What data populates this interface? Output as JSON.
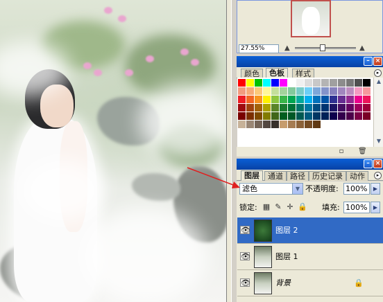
{
  "navigator": {
    "zoom_value": "27.55%",
    "zoom_level_fraction": 0.45
  },
  "swatches_panel": {
    "tabs": [
      {
        "label": "颜色",
        "active": false
      },
      {
        "label": "色板",
        "active": true
      },
      {
        "label": "样式",
        "active": false
      }
    ],
    "colors": [
      "#ff0000",
      "#ffff00",
      "#00c000",
      "#00ffff",
      "#0000ff",
      "#ff00ff",
      "#ffffff",
      "#f0f0f0",
      "#dcdcdc",
      "#c8c8c8",
      "#b4b4b4",
      "#a0a0a0",
      "#8c8c8c",
      "#787878",
      "#505050",
      "#000000",
      "#f29b7f",
      "#f6ab79",
      "#fcc979",
      "#fff799",
      "#c4df9b",
      "#a3d39c",
      "#82ca9c",
      "#7accc8",
      "#6dcff6",
      "#7da7d9",
      "#8393ca",
      "#8781bd",
      "#a186be",
      "#bd8cbf",
      "#f49ac1",
      "#f6989d",
      "#ed1c24",
      "#f26522",
      "#f7941d",
      "#fff200",
      "#8dc63f",
      "#39b54a",
      "#00a651",
      "#00a99d",
      "#00aeef",
      "#0072bc",
      "#0054a6",
      "#2e3192",
      "#662d91",
      "#92278f",
      "#ec008c",
      "#ed145b",
      "#9e0b0f",
      "#a0410d",
      "#a36209",
      "#aba000",
      "#598527",
      "#1a7b30",
      "#007236",
      "#00746b",
      "#0076a3",
      "#004b80",
      "#003471",
      "#1b1464",
      "#440e62",
      "#630460",
      "#9e005d",
      "#9e0039",
      "#790000",
      "#7b2e00",
      "#7d4900",
      "#827b00",
      "#406618",
      "#005e20",
      "#005826",
      "#005952",
      "#005b7f",
      "#003663",
      "#002157",
      "#0d004c",
      "#32004b",
      "#4b0049",
      "#7b0046",
      "#7a0026",
      "#c7b299",
      "#998675",
      "#736357",
      "#534741",
      "#37302a",
      "#c69c6d",
      "#a67c52",
      "#8c6239",
      "#754c24",
      "#603913"
    ]
  },
  "layers_panel": {
    "tabs": [
      {
        "label": "图层",
        "active": true
      },
      {
        "label": "通道",
        "active": false
      },
      {
        "label": "路径",
        "active": false
      },
      {
        "label": "历史记录",
        "active": false
      },
      {
        "label": "动作",
        "active": false
      }
    ],
    "blend_mode": "滤色",
    "opacity_label": "不透明度:",
    "opacity_value": "100%",
    "lock_label": "锁定:",
    "fill_label": "填充:",
    "fill_value": "100%",
    "layers": [
      {
        "name": "图层 2",
        "selected": true,
        "thumb": "green",
        "locked": false,
        "italic": false
      },
      {
        "name": "图层 1",
        "selected": false,
        "thumb": "photo",
        "locked": false,
        "italic": false
      },
      {
        "name": "背景",
        "selected": false,
        "thumb": "photo",
        "locked": true,
        "italic": true
      }
    ]
  },
  "icons": {
    "panel_minimize": "minimize-icon",
    "panel_close": "close-icon",
    "panel_menu": "panel-menu-icon",
    "eye": "eye-icon",
    "lock": "lock-icon"
  }
}
